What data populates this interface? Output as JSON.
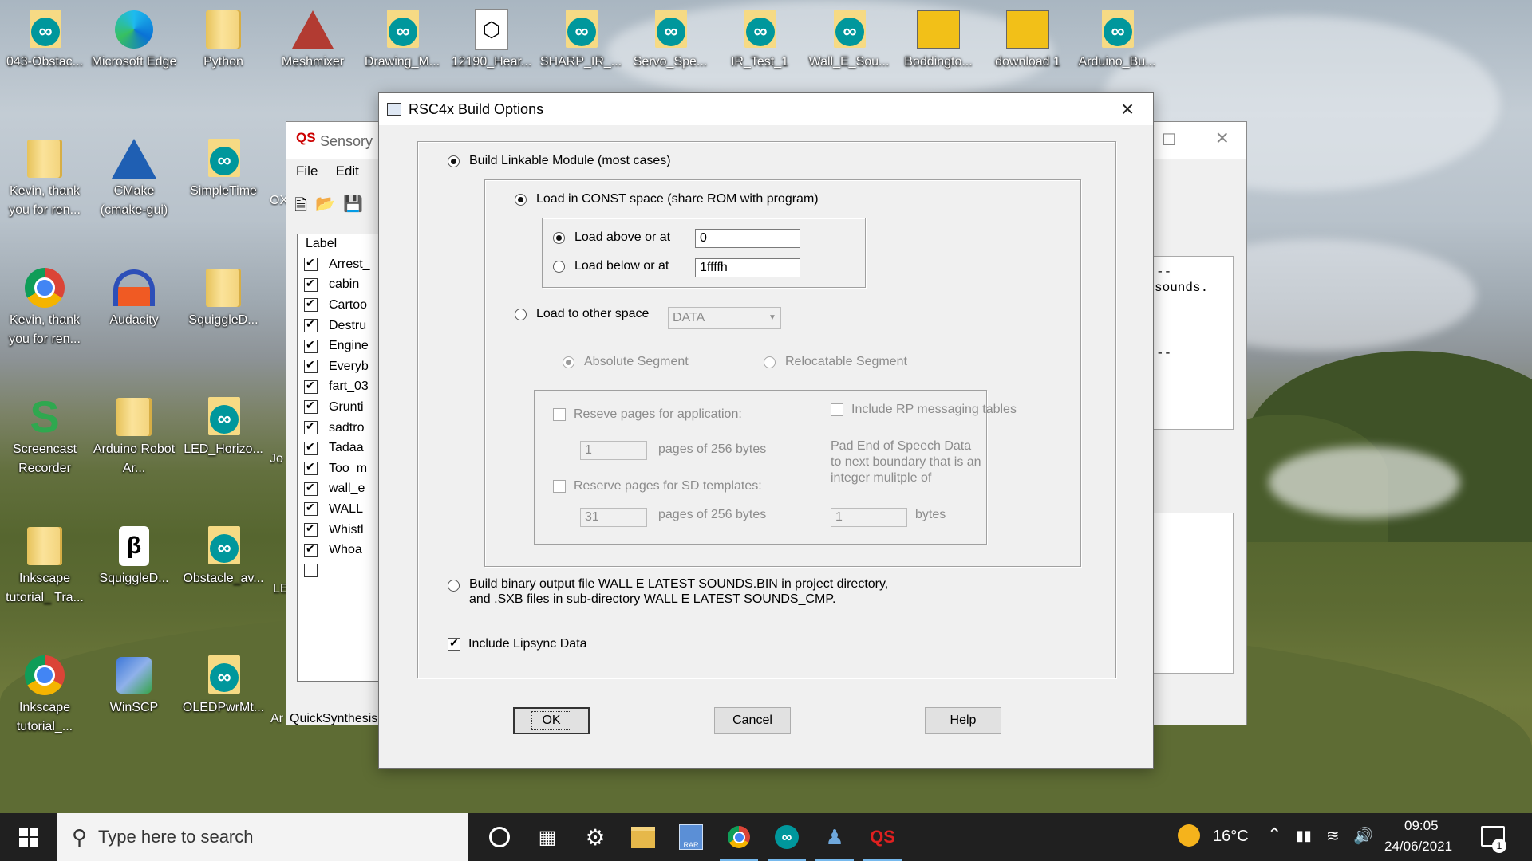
{
  "desktop_icons": [
    {
      "label": "043-Obstac...",
      "type": "arduino"
    },
    {
      "label": "Microsoft Edge",
      "type": "edge"
    },
    {
      "label": "Python",
      "type": "folder"
    },
    {
      "label": "Meshmixer",
      "type": "meshmixer"
    },
    {
      "label": "Drawing_M...",
      "type": "arduino"
    },
    {
      "label": "12190_Hear...",
      "type": "file"
    },
    {
      "label": "SHARP_IR_...",
      "type": "arduino"
    },
    {
      "label": "Servo_Spe...",
      "type": "arduino"
    },
    {
      "label": "IR_Test_1",
      "type": "arduino"
    },
    {
      "label": "Wall_E_Sou...",
      "type": "arduino"
    },
    {
      "label": "Boddingto...",
      "type": "image"
    },
    {
      "label": "download 1",
      "type": "image"
    },
    {
      "label": "Arduino_Bu...",
      "type": "arduino"
    },
    {
      "label": "Kevin, thank you for ren...",
      "type": "folder"
    },
    {
      "label": "CMake (cmake-gui)",
      "type": "cmake"
    },
    {
      "label": "SimpleTime",
      "type": "arduino"
    },
    {
      "label": "Kevin, thank you for ren...",
      "type": "chrome"
    },
    {
      "label": "Audacity",
      "type": "audacity"
    },
    {
      "label": "SquiggleD...",
      "type": "folder"
    },
    {
      "label": "Screencast Recorder",
      "type": "screencast"
    },
    {
      "label": "Arduino Robot Ar...",
      "type": "folder"
    },
    {
      "label": "LED_Horizo...",
      "type": "arduino"
    },
    {
      "label": "Inkscape tutorial_ Tra...",
      "type": "folder"
    },
    {
      "label": "SquiggleD...",
      "type": "squiggle"
    },
    {
      "label": "Obstacle_av...",
      "type": "arduino"
    },
    {
      "label": "Inkscape tutorial_...",
      "type": "chrome"
    },
    {
      "label": "WinSCP",
      "type": "winscp"
    },
    {
      "label": "OLEDPwrMt...",
      "type": "arduino"
    }
  ],
  "partial_labels": [
    "OX",
    "Jo",
    "LE",
    "Ar"
  ],
  "bg_window": {
    "title": "Sensory",
    "app_badge": "QS",
    "menu": [
      "File",
      "Edit"
    ],
    "list_header": "Label",
    "labels": [
      "Arrest_",
      "cabin",
      "Cartoo",
      "Destru",
      "Engine",
      "Everyb",
      "fart_03",
      "Grunti",
      "sadtro",
      "Tadaa",
      "Too_m",
      "wall_e",
      "WALL",
      "Whistl",
      "Whoa",
      ""
    ],
    "code_line_1": "--",
    "code_line_2": "sounds.",
    "code_line_3": "--",
    "status": "QuickSynthesis"
  },
  "dialog": {
    "title": "RSC4x Build Options",
    "build_linkable": "Build Linkable Module (most cases)",
    "load_const": "Load in CONST space  (share ROM with program)",
    "load_above": "Load above or at",
    "load_above_value": "0",
    "load_below": "Load below or at",
    "load_below_value": "1ffffh",
    "load_other": "Load to other space",
    "other_space_value": "DATA",
    "absolute_segment": "Absolute Segment",
    "relocatable_segment": "Relocatable Segment",
    "reserve_app": "Reseve pages for application:",
    "reserve_app_value": "1",
    "pages_text_1": "pages of 256 bytes",
    "reserve_sd": "Reserve pages for SD templates:",
    "reserve_sd_value": "31",
    "pages_text_2": "pages of 256 bytes",
    "include_rp": "Include RP messaging tables",
    "pad_line_1": "Pad End of Speech Data",
    "pad_line_2": "to next boundary that is an",
    "pad_line_3": "integer mulitple of",
    "pad_value": "1",
    "bytes": "bytes",
    "build_binary_line_1": "Build binary output file WALL E LATEST SOUNDS.BIN in project directory,",
    "build_binary_line_2": "and .SXB files in sub-directory WALL E LATEST SOUNDS_CMP.",
    "include_lipsync": "Include Lipsync Data",
    "ok": "OK",
    "cancel": "Cancel",
    "help": "Help"
  },
  "taskbar": {
    "search_placeholder": "Type here to search",
    "weather": "16°C",
    "time": "09:05",
    "date": "24/06/2021",
    "notification_count": "1",
    "rar_label": "RAR",
    "qs_label": "QS"
  }
}
